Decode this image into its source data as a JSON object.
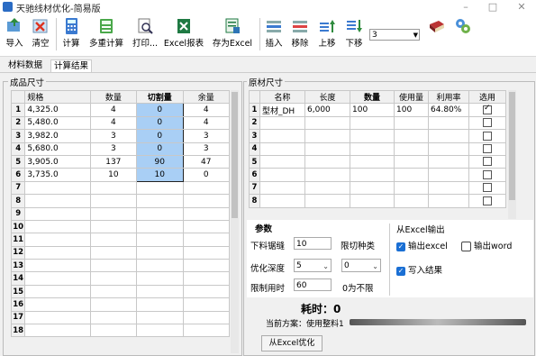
{
  "window": {
    "title": "天驰线材优化-简易版"
  },
  "toolbar": {
    "import": "导入",
    "clear": "清空",
    "calc": "计算",
    "multi_calc": "多重计算",
    "print": "打印...",
    "excel_report": "Excel报表",
    "save_excel": "存为Excel",
    "insert": "插入",
    "remove": "移除",
    "move_up": "上移",
    "move_down": "下移",
    "zoom_value": "3"
  },
  "tabs": {
    "material": "材料数据",
    "result": "计算结果"
  },
  "products": {
    "title": "成品尺寸",
    "headers": [
      "规格",
      "数量",
      "切割量",
      "余量"
    ],
    "rows": [
      {
        "n": "1",
        "spec": "4,325.0",
        "qty": "4",
        "cut": "0",
        "rem": "4"
      },
      {
        "n": "2",
        "spec": "5,480.0",
        "qty": "4",
        "cut": "0",
        "rem": "4"
      },
      {
        "n": "3",
        "spec": "3,982.0",
        "qty": "3",
        "cut": "0",
        "rem": "3"
      },
      {
        "n": "4",
        "spec": "5,680.0",
        "qty": "3",
        "cut": "0",
        "rem": "3"
      },
      {
        "n": "5",
        "spec": "3,905.0",
        "qty": "137",
        "cut": "90",
        "rem": "47"
      },
      {
        "n": "6",
        "spec": "3,735.0",
        "qty": "10",
        "cut": "10",
        "rem": "0"
      }
    ],
    "empty_rows": [
      "7",
      "8",
      "9",
      "10",
      "11",
      "12",
      "13",
      "14",
      "15",
      "16",
      "17",
      "18"
    ]
  },
  "materials": {
    "title": "原材尺寸",
    "headers": [
      "名称",
      "长度",
      "数量",
      "使用量",
      "利用率",
      "选用"
    ],
    "rows": [
      {
        "n": "1",
        "name": "型材_DH",
        "len": "6,000",
        "qty": "100",
        "used": "100",
        "rate": "64.80%",
        "selected": true
      }
    ],
    "empty_rows": [
      "2",
      "3",
      "4",
      "5",
      "6",
      "7",
      "8"
    ]
  },
  "params": {
    "title": "参数",
    "kerf_label": "下料锯缝",
    "kerf_value": "10",
    "limit_kinds_label": "限切种类",
    "depth_label": "优化深度",
    "depth_value": "5",
    "limit_kinds_value": "0",
    "time_limit_label": "限制用时",
    "time_limit_value": "60",
    "no_limit_note": "0为不限"
  },
  "excel_out": {
    "title": "从Excel输出",
    "out_excel": "输出excel",
    "out_excel_checked": true,
    "out_word": "输出word",
    "out_word_checked": false,
    "write_result": "写入结果",
    "write_result_checked": true
  },
  "status": {
    "elapsed_label": "耗时：",
    "elapsed_value": "0",
    "plan_label": "当前方案：",
    "plan_value": "使用整料1",
    "excel_optimize_btn": "从Excel优化"
  }
}
